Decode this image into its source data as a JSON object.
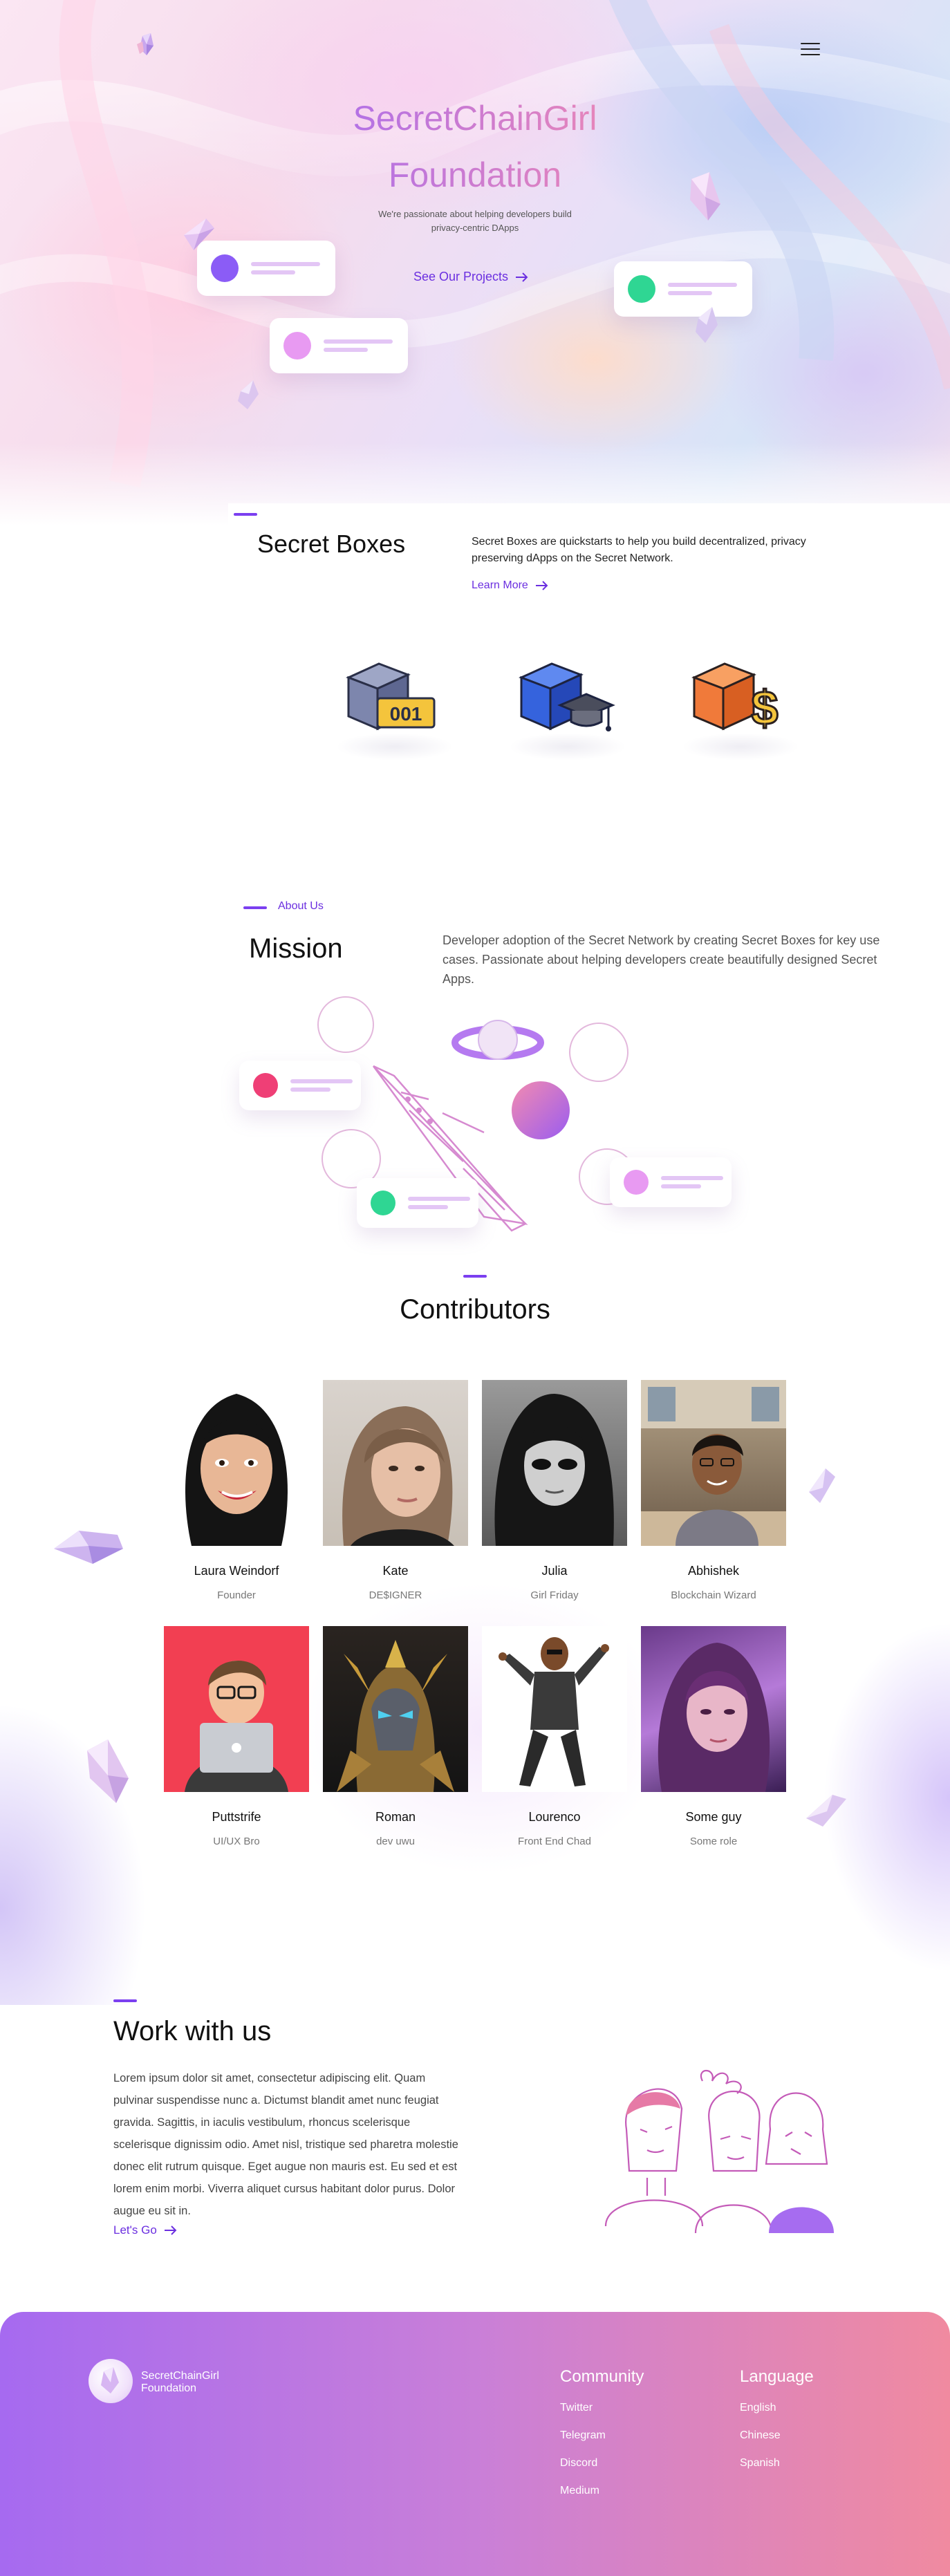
{
  "header": {
    "title_line1": "SecretChainGirl",
    "title_line2": "Foundation",
    "subtitle": "We're passionate about helping developers build privacy-centric DApps",
    "cta_label": "See Our Projects"
  },
  "secret_boxes": {
    "title": "Secret Boxes",
    "description": "Secret Boxes are quickstarts to help you build decentralized, privacy preserving dApps on the Secret Network.",
    "link_label": "Learn More",
    "box_label": "001",
    "box_colors": [
      "#6d79a8",
      "#2f5fd6",
      "#f07a3a"
    ]
  },
  "mission": {
    "label": "About Us",
    "title": "Mission",
    "text": "Developer adoption of the Secret Network by creating Secret Boxes for key use cases. Passionate about helping developers create beautifully designed Secret Apps."
  },
  "contributors": {
    "title": "Contributors",
    "people": [
      {
        "name": "Laura Weindorf",
        "role": "Founder"
      },
      {
        "name": "Kate",
        "role": "DE$IGNER"
      },
      {
        "name": "Julia",
        "role": "Girl Friday"
      },
      {
        "name": "Abhishek",
        "role": "Blockchain Wizard"
      },
      {
        "name": "Puttstrife",
        "role": "UI/UX Bro"
      },
      {
        "name": "Roman",
        "role": "dev uwu"
      },
      {
        "name": "Lourenco",
        "role": "Front End Chad"
      },
      {
        "name": "Some guy",
        "role": "Some role"
      }
    ]
  },
  "work": {
    "title": "Work with us",
    "text": "Lorem ipsum dolor sit amet, consectetur adipiscing elit. Quam pulvinar suspendisse nunc a. Dictumst blandit amet nunc feugiat gravida. Sagittis, in iaculis vestibulum, rhoncus scelerisque scelerisque dignissim odio. Amet nisl, tristique sed pharetra molestie donec elit rutrum quisque. Eget augue non mauris est. Eu sed et est lorem enim morbi. Viverra aliquet cursus habitant dolor purus. Dolor augue eu sit in.",
    "link_label": "Let's Go"
  },
  "footer": {
    "brand_line1": "SecretChainGirl",
    "brand_line2": "Foundation",
    "community_title": "Community",
    "community_links": [
      "Twitter",
      "Telegram",
      "Discord",
      "Medium"
    ],
    "language_title": "Language",
    "language_links": [
      "English",
      "Chinese",
      "Spanish"
    ]
  },
  "colors": {
    "accent": "#6b2fe0",
    "gradient_start": "#a66af0",
    "gradient_end": "#f08aa0"
  },
  "icons": [
    "crystal-logo-icon",
    "menu-icon",
    "arrow-right-icon",
    "rocket-illustration",
    "planet-illustration",
    "people-illustration"
  ]
}
